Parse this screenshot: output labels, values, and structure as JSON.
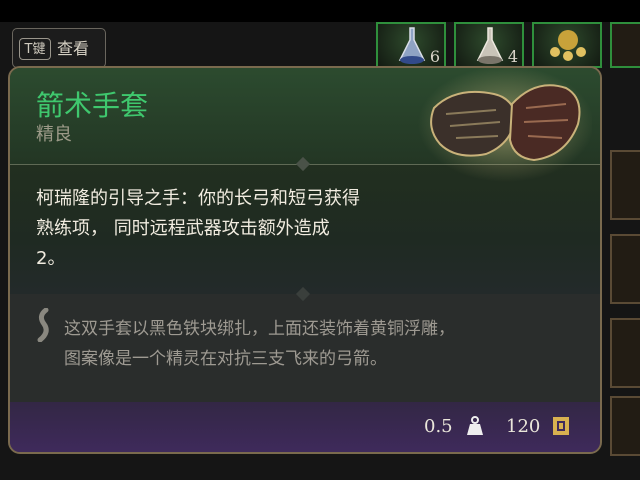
{
  "hint": {
    "key_label": "T键",
    "action_label": "查看"
  },
  "inventory": {
    "slots": [
      {
        "icon": "potion-flask-icon",
        "count": "6"
      },
      {
        "icon": "potion-flask-icon",
        "count": "4"
      },
      {
        "icon": "golden-trinket-icon",
        "count": ""
      }
    ]
  },
  "tooltip": {
    "name": "箭术手套",
    "rarity": "精良",
    "effect_lines": [
      "柯瑞隆的引导之手：你的长弓和短弓获得",
      "熟练项， 同时远程武器攻击额外造成",
      "2。"
    ],
    "lore_lines": [
      "这双手套以黑色铁块绑扎，上面还装饰着黄铜浮雕，",
      "图案像是一个精灵在对抗三支飞来的弓箭。"
    ],
    "weight": "0.5",
    "price": "120",
    "item_icon": "leather-gloves-icon",
    "colors": {
      "name": "#3fc86e",
      "rarity": "#9c9a88",
      "frame": "#7a6a4e",
      "slot_border": "#2f8f3c"
    }
  }
}
